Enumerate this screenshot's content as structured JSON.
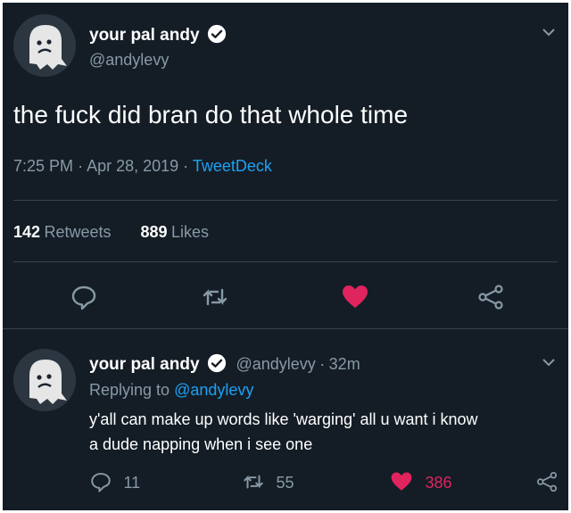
{
  "main_tweet": {
    "display_name": "your pal andy",
    "handle": "@andylevy",
    "text": "the fuck did bran do that whole time",
    "time": "7:25 PM",
    "date": "Apr 28, 2019",
    "source": "TweetDeck",
    "sep1": "·",
    "sep2": "·",
    "retweets_count": "142",
    "retweets_label": "Retweets",
    "likes_count": "889",
    "likes_label": "Likes"
  },
  "reply_tweet": {
    "display_name": "your pal andy",
    "handle": "@andylevy",
    "sep": "·",
    "age": "32m",
    "replying_prefix": "Replying to",
    "replying_to": "@andylevy",
    "text_line1": "y'all can make up words like 'warging' all u want i know",
    "text_line2": "a dude napping when i see one",
    "reply_count": "11",
    "retweet_count": "55",
    "like_count": "386"
  },
  "colors": {
    "background": "#141d26",
    "text": "#ffffff",
    "secondary": "#8899a6",
    "link": "#1da1f2",
    "like": "#e0245e",
    "divider": "#38444d"
  },
  "icons": {
    "avatar": "ghost-avatar-icon",
    "verified": "verified-badge-icon",
    "chevron": "chevron-down-icon",
    "reply": "reply-icon",
    "retweet": "retweet-icon",
    "like": "heart-icon",
    "share": "share-icon"
  }
}
